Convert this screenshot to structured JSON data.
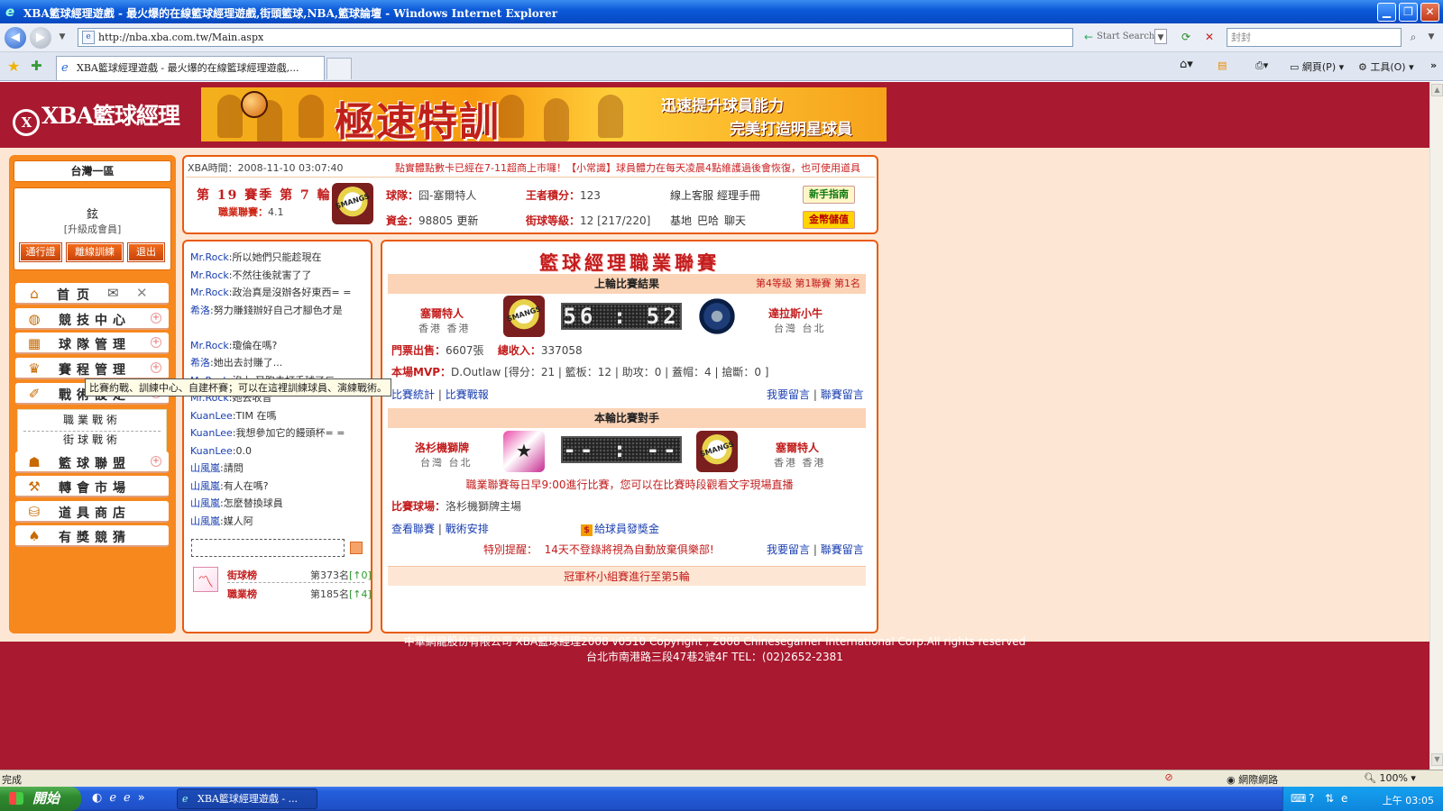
{
  "window": {
    "title": "XBA籃球經理遊戲 - 最火爆的在線籃球經理遊戲,街頭籃球,NBA,籃球論壇 - Windows Internet Explorer"
  },
  "browser": {
    "url": "http://nba.xba.com.tw/Main.aspx",
    "start_search": "Start Search",
    "search_value": "封封",
    "tab_title": "XBA籃球經理遊戲 - 最火爆的在線籃球經理遊戲,...",
    "cmd_page": "網頁(P)",
    "cmd_tools": "工具(O)",
    "status_text": "完成",
    "zone": "網際網路",
    "zoom": "100%"
  },
  "banner": {
    "logo": "XBA籃球經理",
    "headline": "極速特訓",
    "line1": "迅速提升球員能力",
    "line2": "完美打造明星球員"
  },
  "sidebar": {
    "server": "台灣一區",
    "user_name": "鉉",
    "user_level": "[升級成會員]",
    "buttons": [
      "通行證",
      "離線訓練",
      "退出"
    ],
    "menu": [
      {
        "label": "首页",
        "icon": "home-icon"
      },
      {
        "label": "競技中心",
        "icon": "basketball-icon"
      },
      {
        "label": "球隊管理",
        "icon": "team-icon"
      },
      {
        "label": "賽程管理",
        "icon": "trophy-icon"
      },
      {
        "label": "戰術設定",
        "icon": "tactics-icon"
      },
      {
        "label": "籃球聯盟",
        "icon": "league-icon"
      },
      {
        "label": "轉會市場",
        "icon": "hammer-icon"
      },
      {
        "label": "道具商店",
        "icon": "shop-icon"
      },
      {
        "label": "有獎競猜",
        "icon": "guess-icon"
      }
    ],
    "submenu": [
      "職業戰術",
      "街球戰術"
    ],
    "tooltip": "比賽約戰、訓練中心、自建杯賽；可以在這裡訓練球員、演練戰術。"
  },
  "info": {
    "time_label": "XBA時間：",
    "time_value": "2008-11-10 03:07:40",
    "ticker": "點實體點數卡已經在7-11超商上市囉！【小常識】球員體力在每天凌晨4點維護過後會恢復，也可使用道具",
    "season": "第 19 賽季  第 7 輪",
    "pro_label": "職業聯賽：",
    "pro_value": "4.1",
    "team_label": "球隊：",
    "team_value": "囧-塞爾特人",
    "king_label": "王者積分：",
    "king_value": "123",
    "links1": [
      "線上客服",
      "經理手冊"
    ],
    "funds_label": "資金：",
    "funds_value": "98805",
    "funds_refresh": "更新",
    "street_label": "街球等級：",
    "street_value": "12 [217/220]",
    "links2": [
      "基地",
      "巴哈",
      "聊天"
    ],
    "btn_guide": "新手指南",
    "btn_gold": "金幣儲值"
  },
  "chat": {
    "messages": [
      {
        "user": "Mr.Rock",
        "text": ":所以她們只能趁現在"
      },
      {
        "user": "Mr.Rock",
        "text": ":不然往後就害了了"
      },
      {
        "user": "Mr.Rock",
        "text": ":政治真是沒辦各好東西= ="
      },
      {
        "user": "希洛",
        "text": ":努力賺錢辦好自己才腳色才是"
      },
      {
        "user": "",
        "text": ""
      },
      {
        "user": "Mr.Rock",
        "text": ":瓊倫在嗎?"
      },
      {
        "user": "希洛",
        "text": ":她出去討賺了..."
      },
      {
        "user": "Mr.Rock",
        "text": ":沒上 又跑去打手球了ㄏ"
      },
      {
        "user": "Mr.Rock",
        "text": ":她去收音"
      },
      {
        "user": "KuanLee",
        "text": ":TIM 在嗎"
      },
      {
        "user": "KuanLee",
        "text": ":我想參加它的饅頭杯= ="
      },
      {
        "user": "KuanLee",
        "text": ":0.0"
      },
      {
        "user": "山風嵐",
        "text": ":請問"
      },
      {
        "user": "山風嵐",
        "text": ":有人在嗎?"
      },
      {
        "user": "山風嵐",
        "text": ":怎麼替換球員"
      },
      {
        "user": "山風嵐",
        "text": ":媒人阿"
      }
    ],
    "ranks": [
      {
        "label": "街球榜",
        "place": "第373名",
        "change": "[↑0]"
      },
      {
        "label": "職業榜",
        "place": "第185名",
        "change": "[↑4]"
      }
    ]
  },
  "league": {
    "title": "籃球經理職業聯賽",
    "last_header": "上輪比賽結果",
    "last_info": "第4等級  第1聯賽  第1名",
    "last_home": {
      "name": "塞爾特人",
      "loc": "香港 香港"
    },
    "last_away": {
      "name": "達拉斯小牛",
      "loc": "台灣 台北"
    },
    "last_score": "56 : 52",
    "tickets_label": "門票出售：",
    "tickets_value": "6607張",
    "income_label": "總收入：",
    "income_value": "337058",
    "mvp_label": "本場MVP：",
    "mvp_value": "D.Outlaw [得分：21 | 籃板：12 | 助攻：0 | 蓋帽：4 | 搶斷：0 ]",
    "links_a": [
      "比賽統計",
      "比賽戰報"
    ],
    "links_b": [
      "我要留言",
      "聯賽留言"
    ],
    "next_header": "本輪比賽對手",
    "next_home": {
      "name": "洛杉機獅牌",
      "loc": "台灣 台北"
    },
    "next_away": {
      "name": "塞爾特人",
      "loc": "香港 香港"
    },
    "next_score": "-- : --",
    "schedule_note": "職業聯賽每日早9:00進行比賽，您可以在比賽時段觀看文字現場直播",
    "venue_label": "比賽球場：",
    "venue_value": "洛杉機獅牌主場",
    "links_c": [
      "查看聯賽",
      "戰術安排"
    ],
    "salary_link": "給球員發獎金",
    "warning_label": "特別提醒：",
    "warning_value": "14天不登錄將視為自動放棄俱樂部!",
    "links_d": [
      "我要留言",
      "聯賽留言"
    ],
    "cup_note": "冠軍杯小組賽進行至第5輪"
  },
  "footer": {
    "line1": "中華網龍股份有限公司  XBA籃球經理2008 v0510     Copyright , 2008 Chinesegamer International Corp.All rights reserved",
    "line2": "台北市南港路三段47巷2號4F TEL：(02)2652-2381"
  },
  "taskbar": {
    "start": "開始",
    "item": "XBA籃球經理遊戲 - ...",
    "clock": "上午 03:05"
  },
  "colors": {
    "page_red": "#a9192f",
    "orange": "#f7881e",
    "peach": "#fde7d4",
    "accent_red": "#c31c1c"
  }
}
